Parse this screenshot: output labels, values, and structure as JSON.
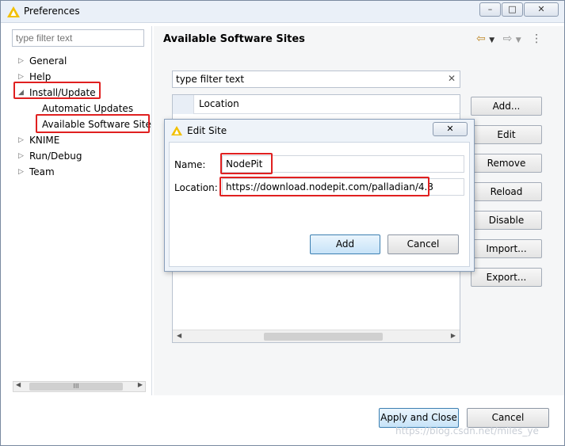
{
  "window": {
    "title": "Preferences",
    "min_icon": "minimize-icon",
    "max_icon": "maximize-icon",
    "close_icon": "close-icon"
  },
  "sidebar": {
    "filter_placeholder": "type filter text",
    "items": [
      {
        "label": "General",
        "expanded": false
      },
      {
        "label": "Help",
        "expanded": false
      },
      {
        "label": "Install/Update",
        "expanded": true
      },
      {
        "label": "Automatic Updates"
      },
      {
        "label": "Available Software Site"
      },
      {
        "label": "KNIME",
        "expanded": false
      },
      {
        "label": "Run/Debug",
        "expanded": false
      },
      {
        "label": "Team",
        "expanded": false
      }
    ],
    "scroll_thumb": "III"
  },
  "main": {
    "title": "Available Software Sites",
    "filter_value": "type filter text",
    "table": {
      "column_location": "Location"
    },
    "buttons": {
      "add": "Add...",
      "edit": "Edit",
      "remove": "Remove",
      "reload": "Reload",
      "disable": "Disable",
      "import": "Import...",
      "export": "Export..."
    }
  },
  "footer": {
    "apply_close": "Apply and Close",
    "cancel": "Cancel",
    "watermark": "https://blog.csdn.net/miles_ye"
  },
  "dialog": {
    "title": "Edit Site",
    "name_label": "Name:",
    "name_value": "NodePit",
    "location_label": "Location:",
    "location_value": "https://download.nodepit.com/palladian/4.3",
    "add": "Add",
    "cancel": "Cancel"
  },
  "colors": {
    "highlight": "#e02020",
    "primary_button": "#c7e3f8",
    "app_icon": "#f2c000"
  }
}
